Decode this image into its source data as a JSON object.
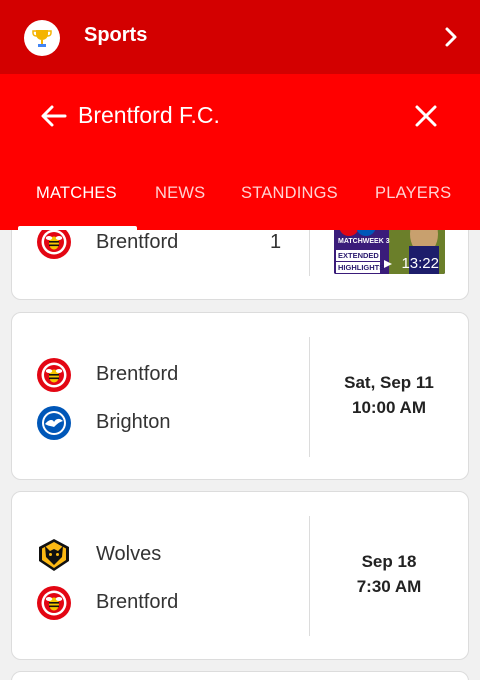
{
  "appbar": {
    "title": "Sports",
    "trophy_icon": "trophy-icon",
    "chevron_icon": "chevron-right-icon"
  },
  "team_header": {
    "title": "Brentford F.C."
  },
  "tabs": [
    {
      "label": "MATCHES",
      "active": true
    },
    {
      "label": "NEWS",
      "active": false
    },
    {
      "label": "STANDINGS",
      "active": false
    },
    {
      "label": "PLAYERS",
      "active": false
    }
  ],
  "matches": [
    {
      "team": "Brentford",
      "score": "1",
      "video": {
        "duration": "13:22",
        "badge": "MATCHWEEK 3",
        "line1": "EXTENDED",
        "line2": "HIGHLIGHTS"
      }
    },
    {
      "teams": [
        "Brentford",
        "Brighton"
      ],
      "date": "Sat, Sep 11",
      "time": "10:00 AM"
    },
    {
      "teams": [
        "Wolves",
        "Brentford"
      ],
      "date": "Sep 18",
      "time": "7:30 AM"
    }
  ],
  "colors": {
    "appbar": "#d30000",
    "team_header": "#ff0000",
    "brentford_red": "#e30613",
    "brighton_blue": "#0057b8",
    "wolves_gold": "#fdb913"
  }
}
